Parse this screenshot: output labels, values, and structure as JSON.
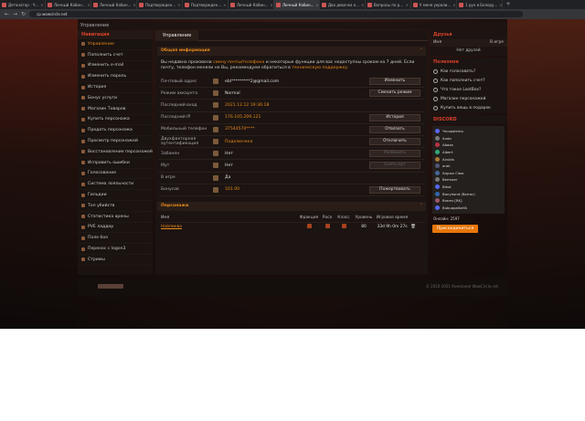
{
  "browser": {
    "tabs": [
      {
        "title": "Детонатор - Ч...",
        "active": false
      },
      {
        "title": "Личный Кабин...",
        "active": false
      },
      {
        "title": "Личный Кабин...",
        "active": false
      },
      {
        "title": "Подтвержден...",
        "active": false
      },
      {
        "title": "Подтвержден...",
        "active": false
      },
      {
        "title": "Личный Кабин...",
        "active": false
      },
      {
        "title": "Личный Кабин...",
        "active": true
      },
      {
        "title": "Два девочка о...",
        "active": false
      },
      {
        "title": "Вопросы по р...",
        "active": false
      },
      {
        "title": "У меня украли...",
        "active": false
      },
      {
        "title": "1 рун в Белору...",
        "active": false
      }
    ],
    "url": "cp.wowcircle.net"
  },
  "topbar": {
    "title": "Управление"
  },
  "sidebar": {
    "heading": "Навигация",
    "items": [
      {
        "label": "Управление",
        "active": true
      },
      {
        "label": "Пополнить счет"
      },
      {
        "label": "Изменить e-mail"
      },
      {
        "label": "Изменить пароль"
      },
      {
        "label": "История"
      },
      {
        "label": "Бонус услуги"
      },
      {
        "label": "Магазин Товаров"
      },
      {
        "label": "Купить персонажа"
      },
      {
        "label": "Продать персонажа"
      },
      {
        "label": "Просмотр персонажей"
      },
      {
        "label": "Восстановление персонажей"
      },
      {
        "label": "Исправить ошибки"
      },
      {
        "label": "Голосование"
      },
      {
        "label": "Система лояльности"
      },
      {
        "label": "Гильдии"
      },
      {
        "label": "Топ убийств"
      },
      {
        "label": "Статистика арены"
      },
      {
        "label": "PVE ладдер"
      },
      {
        "label": "Поле боя"
      },
      {
        "label": "Перенос с logon3"
      },
      {
        "label": "Стримы"
      }
    ]
  },
  "main": {
    "tab_label": "Управление",
    "general_title": "Общая информация",
    "notice_part1": "Вы недавно произвели ",
    "notice_link1": "смену почты/телефона",
    "notice_part2": " и некоторые функции для вас недоступны сроком на 7 дней. Если почту, телефон меняли не Вы, рекомендуем обратиться в ",
    "notice_link2": "техническую поддержку",
    "notice_part3": ".",
    "rows": [
      {
        "label": "Почтовый адрес",
        "value": "ebl*********2@gmail.com",
        "button": "Изменить",
        "orange": false,
        "disabled": false
      },
      {
        "label": "Режим аккаунта",
        "value": "Normal",
        "button": "Сменить режим",
        "orange": false,
        "disabled": false
      },
      {
        "label": "Последний вход",
        "value": "2021.12.12 19:36:18",
        "button": "",
        "orange": true,
        "disabled": false
      },
      {
        "label": "Последний IP",
        "value": "176.105.209.121",
        "button": "История",
        "orange": true,
        "disabled": false
      },
      {
        "label": "Мобильный телефон",
        "value": "37544570****",
        "button": "Отвязать",
        "orange": true,
        "disabled": false
      },
      {
        "label": "Двухфакторная аутентификация",
        "value": "Подключена",
        "button": "Отключить",
        "orange": true,
        "disabled": false
      },
      {
        "label": "Забанен",
        "value": "Нет",
        "button": "Разбанить",
        "orange": false,
        "disabled": true
      },
      {
        "label": "Мут",
        "value": "Нет",
        "button": "Снять мут",
        "orange": false,
        "disabled": true
      },
      {
        "label": "В игре",
        "value": "Да",
        "button": "",
        "orange": false,
        "disabled": false
      },
      {
        "label": "Бонусов",
        "value": "101.00",
        "button": "Пожертвовать",
        "orange": true,
        "disabled": false
      }
    ],
    "chars_title": "Персонажи",
    "char_headers": {
      "name": "Имя",
      "faction": "Фракция",
      "race": "Раса",
      "class": "Класс",
      "level": "Уровень",
      "time": "Игровое время"
    },
    "character": {
      "name": "Найлмква",
      "level": "80",
      "time": "33d 9h 0m 27s"
    }
  },
  "right": {
    "friends_title": "Друзья",
    "friends_col_name": "Имя",
    "friends_col_status": "В игре",
    "no_friends": "Нет друзей",
    "help_title": "Полезное",
    "help_links": [
      "Как голосовать?",
      "Как пополнить счет?",
      "Что такое LootBox?",
      "Магазин персонажей",
      "Купить вещь в подарок"
    ],
    "discord_title": "DISCORD",
    "discord_users": [
      "*ecopalemo",
      "Audo",
      "Abaza",
      "Albert",
      "Anubis",
      "arak",
      "Argusz Claw",
      "Bermoer",
      "Blext",
      "Bonyhand (Barrac)",
      "Brams [RK]",
      "BubuopalkaYA"
    ],
    "online": "Онлайн: 2597",
    "join_label": "Присоединиться"
  },
  "footer": {
    "copyright": "© 2010-2021 Компания WowCircle.net"
  },
  "colors": {
    "accent": "#e88a1a",
    "heading_red": "#d8402a",
    "join_button": "#e8760a"
  }
}
